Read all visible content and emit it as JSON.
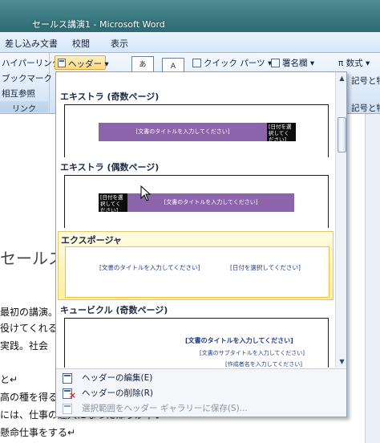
{
  "window": {
    "title": "セールス講演1 - Microsoft Word"
  },
  "tabs": [
    "差し込み文書",
    "校閲",
    "表示"
  ],
  "ribbon": {
    "links_group": {
      "items": [
        "ハイパーリンク",
        "ブックマーク",
        "相互参照"
      ],
      "label": "リンク"
    },
    "header_button": "ヘッダー ▾",
    "quick_parts": "クイック パーツ ▾",
    "signature": "署名欄 ▾",
    "equation": "π 数式 ▾",
    "symbol_right_1": "記号と特",
    "symbol_right_2": "記号と特",
    "box_text_1": "あ",
    "box_text_2": "A"
  },
  "document": {
    "heading": "セールス",
    "lines": [
      "最初の講演。",
      "役けてくれる",
      "実践。社会",
      "と↵",
      "高の種を得る",
      "には、仕事の達人になったほうが早い↵",
      "懸命仕事をする↵"
    ]
  },
  "gallery": {
    "items": [
      {
        "title": "エキストラ (奇数ページ)",
        "band_text": "[文書のタイトルを入力してください]",
        "box_text": "[日付を選択してください]"
      },
      {
        "title": "エキストラ (偶数ページ)",
        "band_text": "[文書のタイトルを入力してください]",
        "box_text": "[日付を選択してください]"
      },
      {
        "title": "エクスポージャ",
        "left_text": "[文書のタイトルを入力してください]",
        "right_text": "[日付を選択してください]"
      },
      {
        "title": "キュービクル (奇数ページ)",
        "line1": "[文書のタイトルを入力してください]",
        "line2": "[文書のサブタイトルを入力してください]",
        "line3": "[作成者名を入力してください]"
      }
    ]
  },
  "menu": {
    "edit": "ヘッダーの編集(E)",
    "delete": "ヘッダーの削除(R)",
    "save": "選択範囲をヘッダー ギャラリーに保存(S)..."
  },
  "colors": {
    "band": "#8b64ab",
    "highlight": "#ffef9f"
  }
}
